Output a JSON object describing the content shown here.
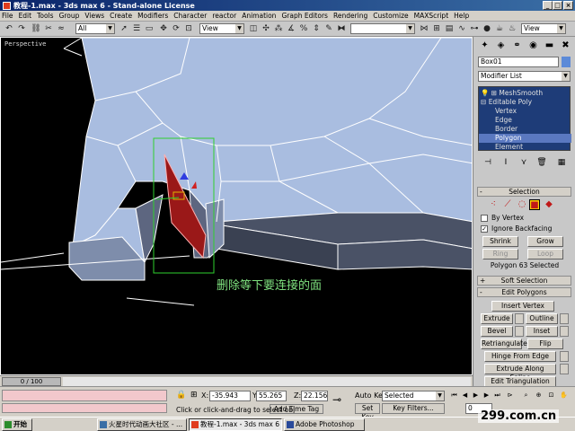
{
  "window": {
    "title": "教程-1.max - 3ds max 6 - Stand-alone License",
    "minimize": "_",
    "maximize": "□",
    "close": "×"
  },
  "menu": [
    "File",
    "Edit",
    "Tools",
    "Group",
    "Views",
    "Create",
    "Modifiers",
    "Character",
    "reactor",
    "Animation",
    "Graph Editors",
    "Rendering",
    "Customize",
    "MAXScript",
    "Help"
  ],
  "toolbar": {
    "selection_filter": "All",
    "ref_coord": "View",
    "named_selection": "",
    "render_dropdown": "View"
  },
  "viewport": {
    "label": "Perspective",
    "annotation": "删除等下要连接的面"
  },
  "timeline": {
    "frame": "0 / 100"
  },
  "status": {
    "x_label": "X:",
    "x_value": "-35.943",
    "y_label": "Y:",
    "y_value": "55.265",
    "z_label": "Z:",
    "z_value": "22.156",
    "prompt": "Click or click-and-drag to select obj",
    "add_time_tag": "Add Time Tag",
    "auto_key": "Auto Key",
    "set_key": "Set Key",
    "key_mode": "Selected",
    "key_filters": "Key Filters...",
    "frame_value": "0"
  },
  "command_panel": {
    "object_name": "Box01",
    "object_color": "#5c8ad8",
    "modifier_list": "Modifier List",
    "stack": [
      {
        "label": "MeshSmooth",
        "level": 0
      },
      {
        "label": "Editable Poly",
        "level": 0
      },
      {
        "label": "Vertex",
        "level": 1
      },
      {
        "label": "Edge",
        "level": 1
      },
      {
        "label": "Border",
        "level": 1
      },
      {
        "label": "Polygon",
        "level": 1,
        "selected": true
      },
      {
        "label": "Element",
        "level": 1
      }
    ],
    "selection_rollout": "Selection",
    "by_vertex": "By Vertex",
    "ignore_backfacing": "Ignore Backfacing",
    "shrink": "Shrink",
    "grow": "Grow",
    "ring": "Ring",
    "loop": "Loop",
    "selection_info": "Polygon 63 Selected",
    "soft_selection": "Soft Selection",
    "edit_polygons": "Edit Polygons",
    "insert_vertex": "Insert Vertex",
    "extrude": "Extrude",
    "outline": "Outline",
    "bevel": "Bevel",
    "inset": "Inset",
    "retriangulate": "Retriangulate",
    "flip": "Flip",
    "hinge_from_edge": "Hinge From Edge",
    "extrude_along_spline": "Extrude Along Spline",
    "edit_triangulation": "Edit Triangulation"
  },
  "taskbar": {
    "start": "开始",
    "tasks": [
      "火星时代动画大社区 - ...",
      "教程-1.max - 3ds max 6 -...",
      "Adobe Photoshop"
    ]
  },
  "watermark": "299.com.cn"
}
